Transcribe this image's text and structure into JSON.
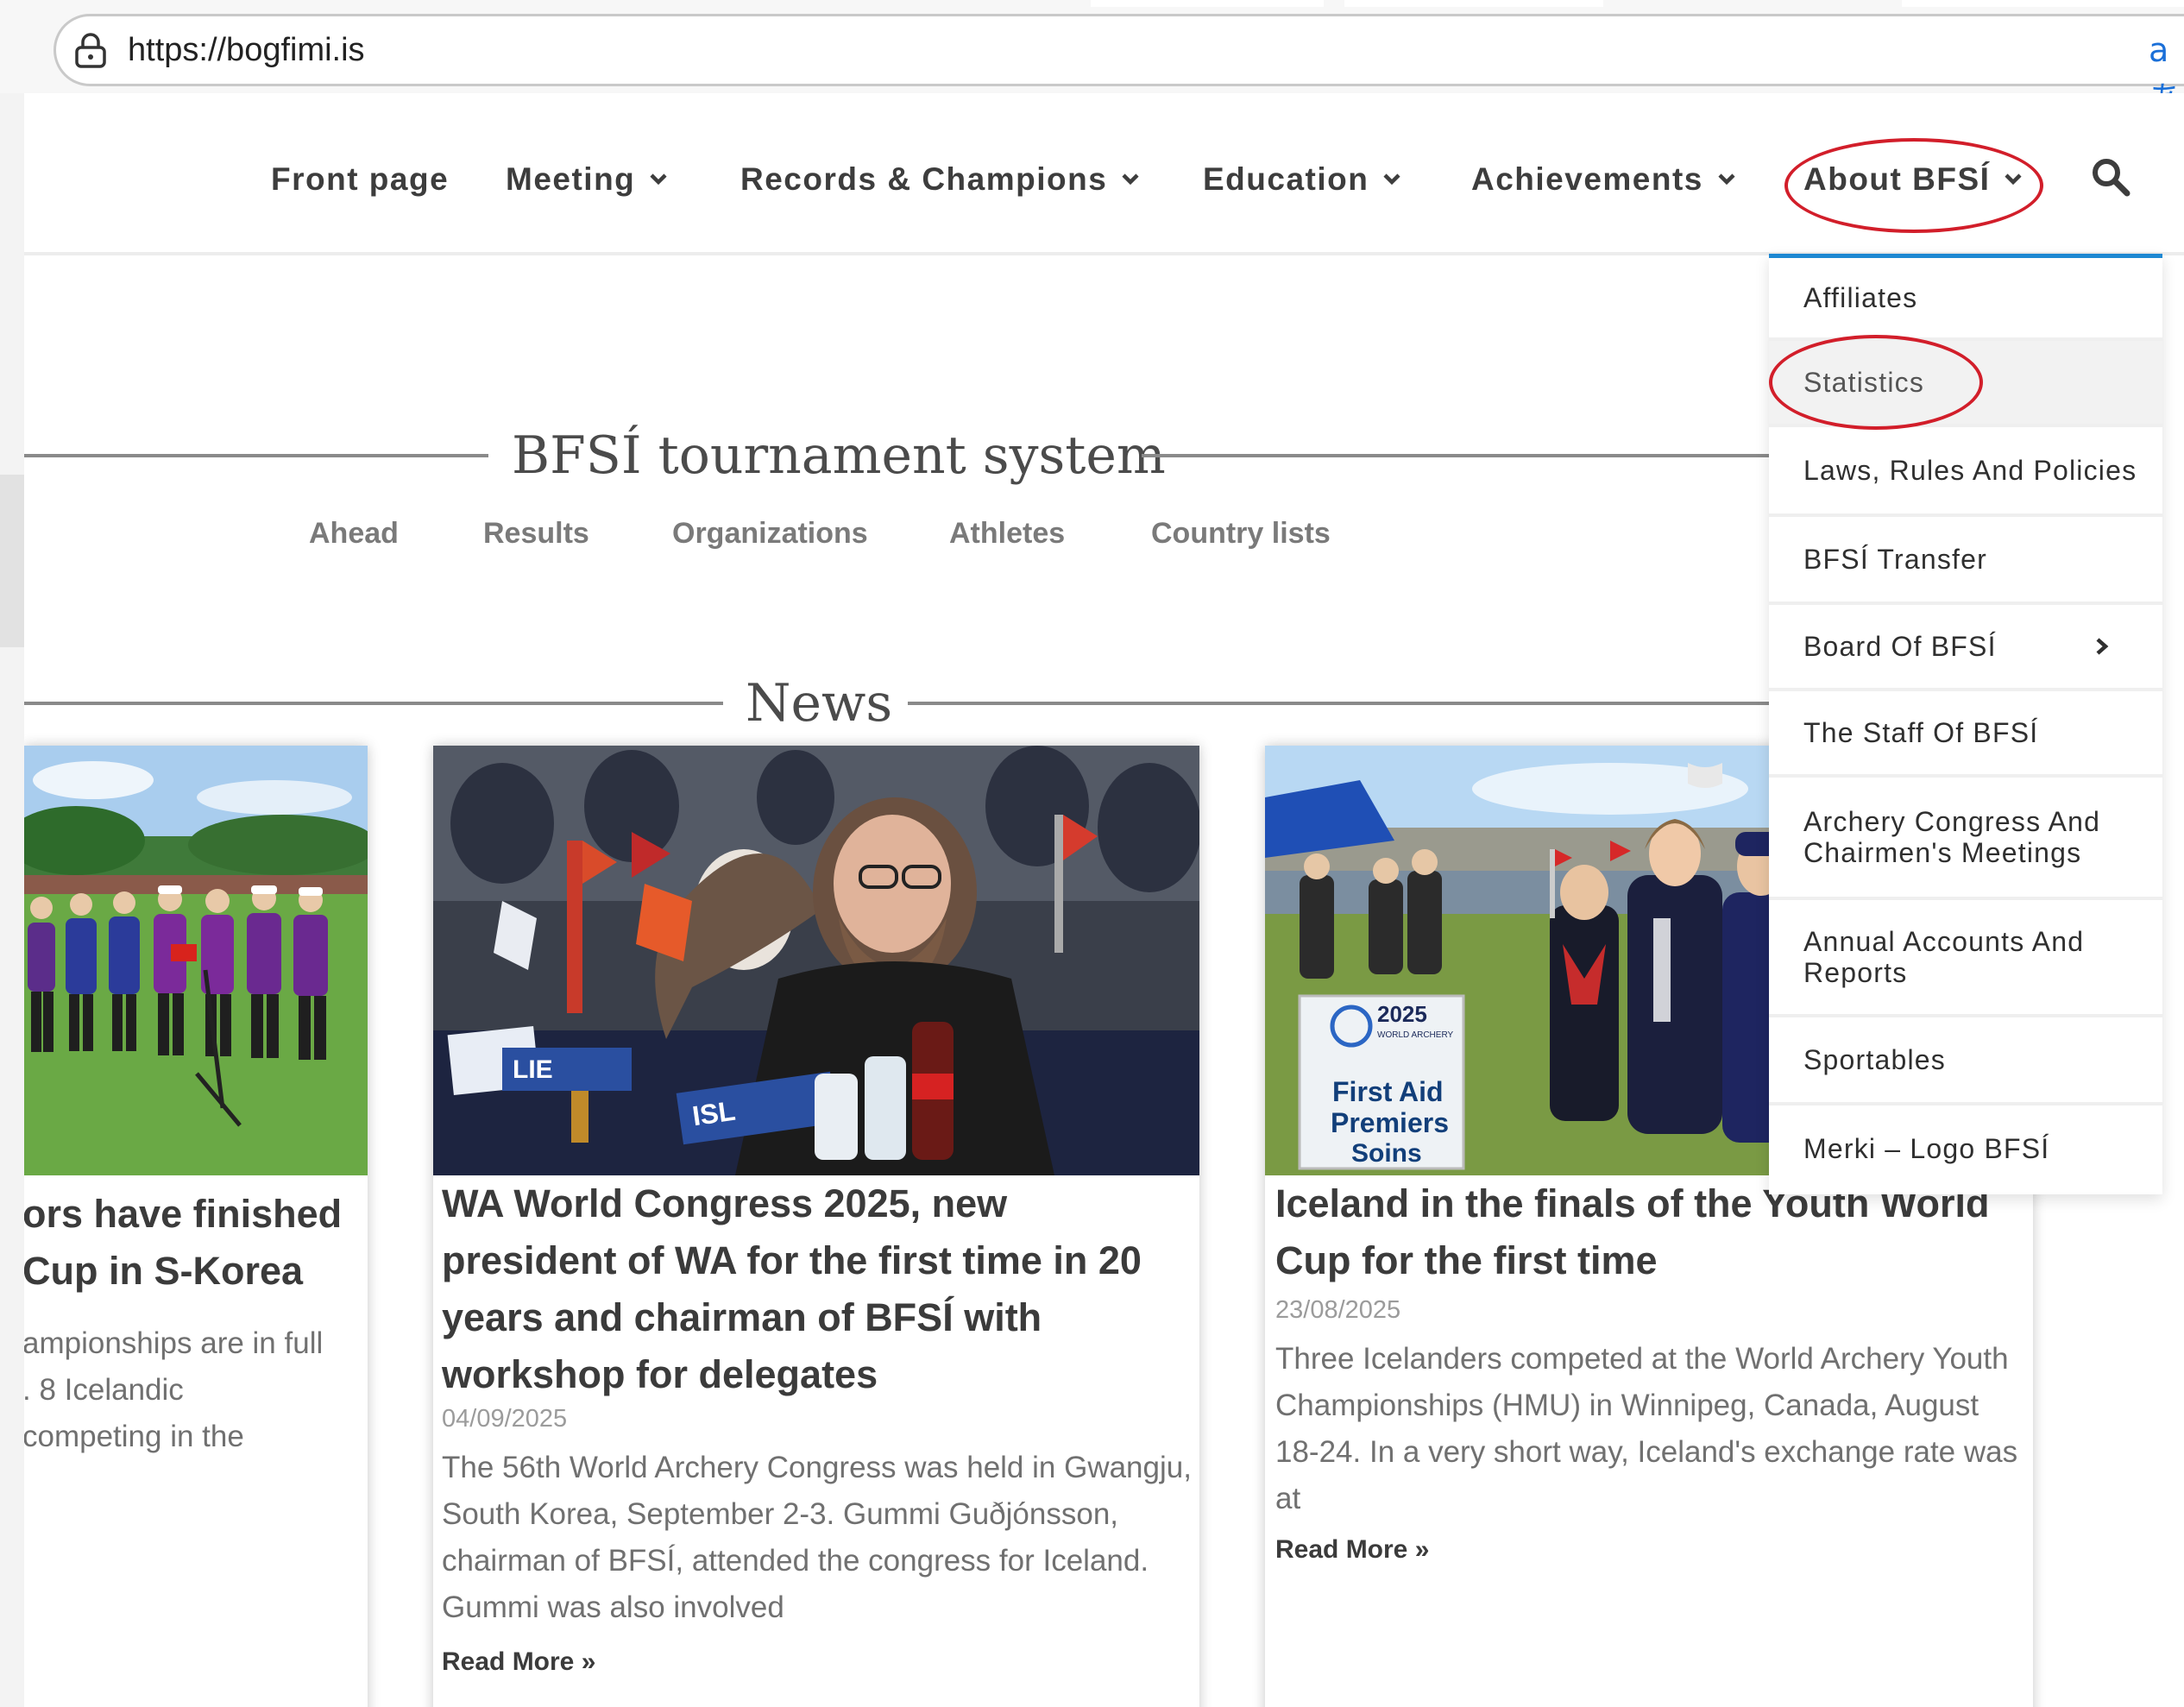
{
  "browser": {
    "url": "https://bogfimi.is",
    "translate_glyph": "aあ"
  },
  "nav": {
    "items": [
      {
        "label": "Front page",
        "has_dropdown": false
      },
      {
        "label": "Meeting",
        "has_dropdown": true
      },
      {
        "label": "Records & Champions",
        "has_dropdown": true
      },
      {
        "label": "Education",
        "has_dropdown": true
      },
      {
        "label": "Achievements",
        "has_dropdown": true
      },
      {
        "label": "About BFSÍ",
        "has_dropdown": true,
        "active": true
      }
    ],
    "search_icon": "search-icon"
  },
  "tournament": {
    "heading": "BFSÍ tournament system",
    "links": [
      "Ahead",
      "Results",
      "Organizations",
      "Athletes",
      "Country lists"
    ]
  },
  "news": {
    "heading": "News",
    "cards": [
      {
        "title_lines": [
          "ors have finished",
          "Cup in S-Korea"
        ],
        "excerpt_lines": [
          "ampionships are in full",
          ". 8 Icelandic",
          "competing in the"
        ]
      },
      {
        "title": "WA World Congress 2025, new president of WA for the first time in 20 years and chairman of BFSÍ with workshop for delegates",
        "date": "04/09/2025",
        "excerpt": "The 56th World Archery Congress was held in Gwangju, South Korea, September 2-3. Gummi Guðjónsson, chairman of BFSÍ, attended the congress for Iceland. Gummi was also involved",
        "read_more": "Read More »"
      },
      {
        "title": "Iceland in the finals of the Youth World Cup for the first time",
        "date": "23/08/2025",
        "excerpt": "Three Icelanders competed at the World Archery Youth Championships (HMU) in Winnipeg, Canada, August 18-24. In a very short way, Iceland's exchange rate was at",
        "read_more": "Read More »",
        "image_sign": [
          "2025",
          "WORLD ARCHERY",
          "First Aid",
          "Premiers",
          "Soins"
        ]
      }
    ]
  },
  "dropdown": {
    "items": [
      {
        "label": "Affiliates"
      },
      {
        "label": "Statistics",
        "hovered": true
      },
      {
        "label": "Laws, Rules And Policies"
      },
      {
        "label": "BFSÍ Transfer"
      },
      {
        "label": "Board Of BFSÍ",
        "has_submenu": true
      },
      {
        "label": "The Staff Of BFSÍ"
      },
      {
        "label": "Archery Congress And Chairmen's Meetings"
      },
      {
        "label": "Annual Accounts And Reports"
      },
      {
        "label": "Sportables"
      },
      {
        "label": "Merki – Logo BFSÍ"
      }
    ]
  },
  "colors": {
    "accent_blue": "#1e88d2",
    "annotation_red": "#d21e2a",
    "nav_text": "#3d3d3d"
  }
}
